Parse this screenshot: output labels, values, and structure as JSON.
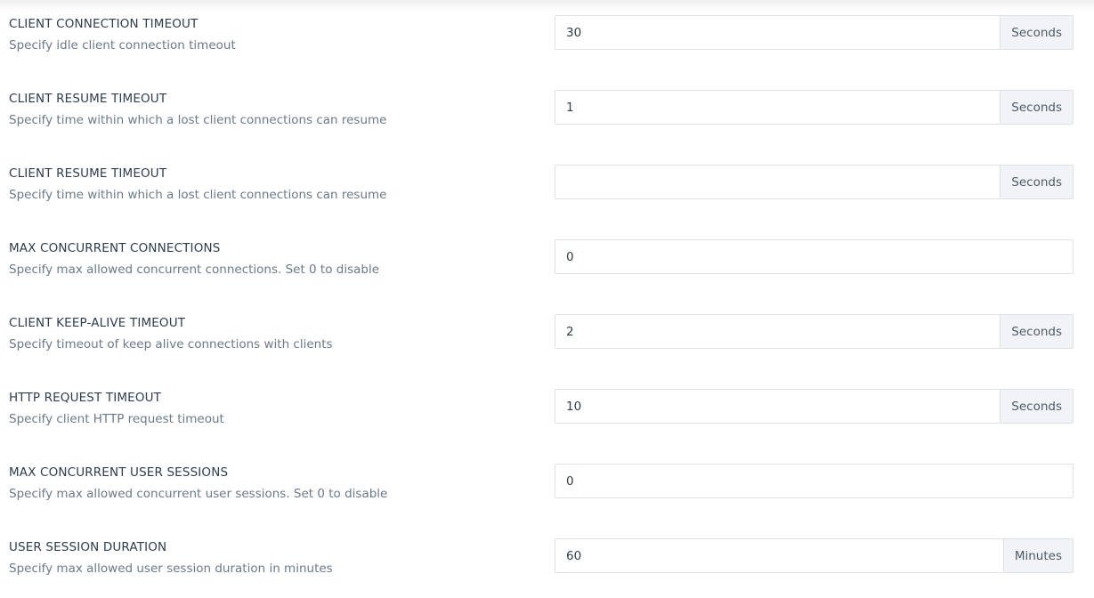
{
  "settings": [
    {
      "title": "CLIENT CONNECTION TIMEOUT",
      "description": "Specify idle client connection timeout",
      "value": "30",
      "unit": "Seconds"
    },
    {
      "title": "CLIENT RESUME TIMEOUT",
      "description": "Specify time within which a lost client connections can resume",
      "value": "1",
      "unit": "Seconds"
    },
    {
      "title": "CLIENT RESUME TIMEOUT",
      "description": "Specify time within which a lost client connections can resume",
      "value": "",
      "unit": "Seconds"
    },
    {
      "title": "MAX CONCURRENT CONNECTIONS",
      "description": "Specify max allowed concurrent connections. Set 0 to disable",
      "value": "0",
      "unit": ""
    },
    {
      "title": "CLIENT KEEP-ALIVE TIMEOUT",
      "description": "Specify timeout of keep alive connections with clients",
      "value": "2",
      "unit": "Seconds"
    },
    {
      "title": "HTTP REQUEST TIMEOUT",
      "description": "Specify client HTTP request timeout",
      "value": "10",
      "unit": "Seconds"
    },
    {
      "title": "MAX CONCURRENT USER SESSIONS",
      "description": "Specify max allowed concurrent user sessions. Set 0 to disable",
      "value": "0",
      "unit": ""
    },
    {
      "title": "USER SESSION DURATION",
      "description": "Specify max allowed user session duration in minutes",
      "value": "60",
      "unit": "Minutes"
    }
  ]
}
